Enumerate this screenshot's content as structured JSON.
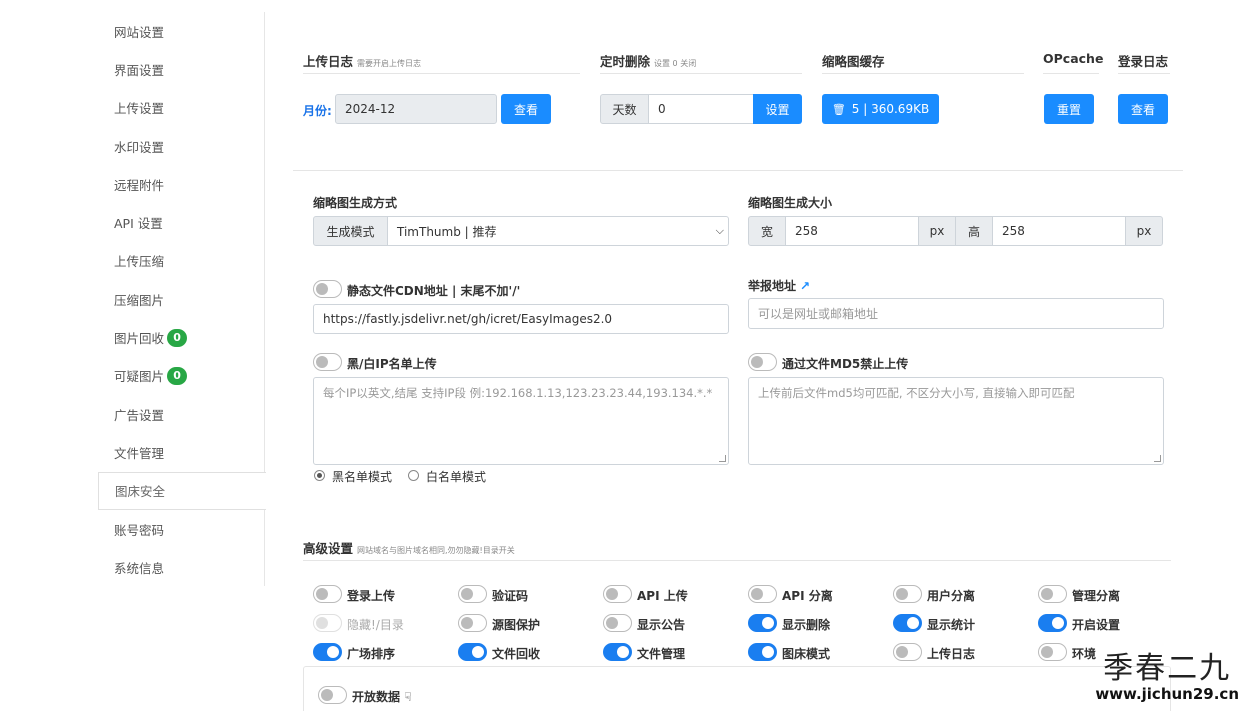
{
  "sidebar": {
    "items": [
      {
        "label": "网站设置"
      },
      {
        "label": "界面设置"
      },
      {
        "label": "上传设置"
      },
      {
        "label": "水印设置"
      },
      {
        "label": "远程附件"
      },
      {
        "label": "API 设置"
      },
      {
        "label": "上传压缩"
      },
      {
        "label": "压缩图片"
      },
      {
        "label": "图片回收",
        "badge": "0"
      },
      {
        "label": "可疑图片",
        "badge": "0"
      },
      {
        "label": "广告设置"
      },
      {
        "label": "文件管理"
      },
      {
        "label": "图床安全",
        "active": true
      },
      {
        "label": "账号密码"
      },
      {
        "label": "系统信息"
      }
    ]
  },
  "upload_log": {
    "title": "上传日志",
    "hint": "需要开启上传日志",
    "month_label": "月份:",
    "month_value": "2024-12",
    "view_button": "查看"
  },
  "scheduled_delete": {
    "title": "定时删除",
    "hint": "设置 0 关闭",
    "days_label": "天数",
    "days_value": "0",
    "set_button": "设置"
  },
  "thumb_cache": {
    "title": "缩略图缓存",
    "button": "5 | 360.69KB"
  },
  "opcache": {
    "title": "OPcache",
    "button": "重置"
  },
  "login_log": {
    "title": "登录日志",
    "button": "查看"
  },
  "thumb_method": {
    "label": "缩略图生成方式",
    "mode_label": "生成模式",
    "selected": "TimThumb | 推荐"
  },
  "thumb_size": {
    "label": "缩略图生成大小",
    "width_label": "宽",
    "width_value": "258",
    "unit": "px",
    "height_label": "高",
    "height_value": "258"
  },
  "cdn": {
    "label": "静态文件CDN地址 | 末尾不加'/'",
    "value": "https://fastly.jsdelivr.net/gh/icret/EasyImages2.0"
  },
  "report": {
    "label": "举报地址",
    "placeholder": "可以是网址或邮箱地址"
  },
  "ip_list": {
    "label": "黑/白IP名单上传",
    "placeholder": "每个IP以英文,结尾 支持IP段 例:192.168.1.13,123.23.23.44,193.134.*.*",
    "mode_black": "黑名单模式",
    "mode_white": "白名单模式"
  },
  "md5": {
    "label": "通过文件MD5禁止上传",
    "placeholder": "上传前后文件md5均可匹配, 不区分大小写, 直接输入即可匹配"
  },
  "advanced": {
    "title": "高级设置",
    "hint": "网站域名与图片域名相同,勿勿隐藏!目录开关",
    "toggles": [
      {
        "label": "登录上传",
        "on": false
      },
      {
        "label": "验证码",
        "on": false
      },
      {
        "label": "API 上传",
        "on": false
      },
      {
        "label": "API 分离",
        "on": false
      },
      {
        "label": "用户分离",
        "on": false
      },
      {
        "label": "管理分离",
        "on": false
      },
      {
        "label": "隐藏!/目录",
        "on": false,
        "disabled": true
      },
      {
        "label": "源图保护",
        "on": false
      },
      {
        "label": "显示公告",
        "on": false
      },
      {
        "label": "显示删除",
        "on": true
      },
      {
        "label": "显示统计",
        "on": true
      },
      {
        "label": "开启设置",
        "on": true
      },
      {
        "label": "广场排序",
        "on": true
      },
      {
        "label": "文件回收",
        "on": true
      },
      {
        "label": "文件管理",
        "on": true
      },
      {
        "label": "图床模式",
        "on": true
      },
      {
        "label": "上传日志",
        "on": false
      },
      {
        "label": "环境",
        "on": false
      }
    ],
    "open_data": "开放数据"
  },
  "watermark": {
    "big": "季春二九",
    "small": "www.jichun29.cn"
  }
}
